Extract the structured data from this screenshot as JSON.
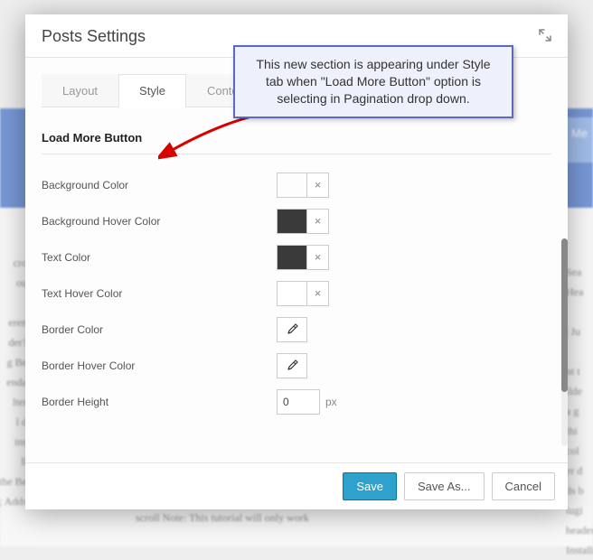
{
  "bg": {
    "accent_text": "Me",
    "left_frag": "cro\nou\n\neren\nder?\ng Be\nenda\nlter\nl d\nins\nll\ng the Beaver\n; Adds",
    "right_frag": "Sea\nHea\n\n| Ju\n\nnt t\nilde\na g\nthi\ncol\ner d\nds b\nlugi\nheader will b\nInstall/Acti",
    "mid_frag": "scroll Note: This tutorial will only work"
  },
  "modal": {
    "title": "Posts Settings",
    "tabs": {
      "layout": "Layout",
      "style": "Style",
      "content": "Conte"
    },
    "section_heading": "Load More Button",
    "fields": {
      "bg_color": {
        "label": "Background Color",
        "value": "#e8e8e8"
      },
      "bg_hover": {
        "label": "Background Hover Color",
        "value": "#3a3a3a"
      },
      "text_color": {
        "label": "Text Color",
        "value": "#3a3a3a"
      },
      "text_hover": {
        "label": "Text Hover Color",
        "value": ""
      },
      "border_color": {
        "label": "Border Color"
      },
      "border_hover": {
        "label": "Border Hover Color"
      },
      "border_height": {
        "label": "Border Height",
        "value": "0",
        "unit": "px"
      }
    },
    "buttons": {
      "save": "Save",
      "save_as": "Save As...",
      "cancel": "Cancel"
    }
  },
  "callout": "This new section is appearing under Style tab when \"Load More Button\" option is selecting in Pagination drop down."
}
